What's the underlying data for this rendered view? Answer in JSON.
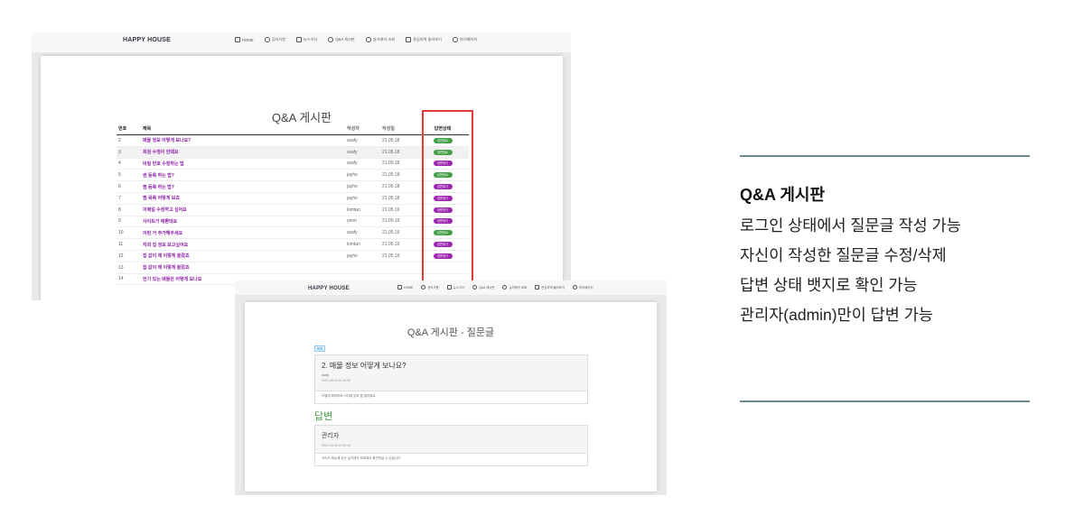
{
  "list_screen": {
    "brand": "HAPPY HOUSE",
    "nav": [
      {
        "icon": "home-icon",
        "label": "HOME"
      },
      {
        "icon": "info-icon",
        "label": "공지사항"
      },
      {
        "icon": "news-icon",
        "label": "뉴스기사"
      },
      {
        "icon": "qna-icon",
        "label": "Q&A 게시판"
      },
      {
        "icon": "search-icon",
        "label": "실거래가 조회"
      },
      {
        "icon": "bookmark-icon",
        "label": "관심지역 둘러보기"
      },
      {
        "icon": "user-icon",
        "label": "마이페이지"
      }
    ],
    "title": "Q&A 게시판",
    "columns": {
      "no": "번호",
      "title": "제목",
      "author": "작성자",
      "date": "작성일",
      "status": "답변상태"
    },
    "rows": [
      {
        "no": "2",
        "title": "매물 정보 어떻게 보나요?",
        "author": "ssafy",
        "date": "21.05.18",
        "status": "답변완료",
        "state": "done"
      },
      {
        "no": "3",
        "title": "회원 수정이 안돼요",
        "author": "ssafy",
        "date": "21.05.18",
        "status": "답변완료",
        "state": "done"
      },
      {
        "no": "4",
        "title": "비밀 번호 수정하는 법",
        "author": "ssafy",
        "date": "21.05.18",
        "status": "답변대기",
        "state": "wait"
      },
      {
        "no": "5",
        "title": "썸 등록 하는 법?",
        "author": "jayho",
        "date": "21.05.18",
        "status": "답변완료",
        "state": "done"
      },
      {
        "no": "6",
        "title": "찜 등록 하는 법?",
        "author": "jayho",
        "date": "21.05.18",
        "status": "답변대기",
        "state": "wait"
      },
      {
        "no": "7",
        "title": "찜 목록 어떻게 보죠",
        "author": "jayho",
        "date": "21.05.18",
        "status": "답변대기",
        "state": "wait"
      },
      {
        "no": "8",
        "title": "이메일 수정하고 싶어요",
        "author": "kimtan",
        "date": "21.05.19",
        "status": "답변대기",
        "state": "wait"
      },
      {
        "no": "9",
        "title": "사이트가 예쁜데요",
        "author": "yeon",
        "date": "21.05.19",
        "status": "답변대기",
        "state": "wait"
      },
      {
        "no": "10",
        "title": "이런 거 추가해주세요",
        "author": "ssafy",
        "date": "21.05.19",
        "status": "답변완료",
        "state": "done"
      },
      {
        "no": "11",
        "title": "저희 집 정보 보고싶어요",
        "author": "kimtan",
        "date": "21.05.19",
        "status": "답변대기",
        "state": "wait"
      },
      {
        "no": "12",
        "title": "집 값이 왜 이렇게 올랐죠",
        "author": "jayho",
        "date": "21.05.19",
        "status": "답변대기",
        "state": "wait"
      },
      {
        "no": "13",
        "title": "집 값이 왜 이렇게 올랐죠",
        "author": "",
        "date": "",
        "status": "",
        "state": ""
      },
      {
        "no": "14",
        "title": "인기 있는 매물은 어떻게 보나요",
        "author": "",
        "date": "",
        "status": "",
        "state": ""
      }
    ]
  },
  "detail_screen": {
    "brand": "HAPPY HOUSE",
    "nav": [
      {
        "icon": "home-icon",
        "label": "HOME"
      },
      {
        "icon": "info-icon",
        "label": "공지사항"
      },
      {
        "icon": "news-icon",
        "label": "뉴스기사"
      },
      {
        "icon": "qna-icon",
        "label": "Q&A 게시판"
      },
      {
        "icon": "search-icon",
        "label": "실거래가 조회"
      },
      {
        "icon": "bookmark-icon",
        "label": "관심지역 둘러보기"
      },
      {
        "icon": "user-icon",
        "label": "마이페이지"
      }
    ],
    "title": "Q&A 게시판 - 질문글",
    "list_button": "목록",
    "question": {
      "title": "2. 매물 정보 어떻게 보나요?",
      "author": "ssafy",
      "date": "2021.05.18 15:38:00",
      "body": "어떻게 봐야하죠 어디에 있죠 좀 알려줘요"
    },
    "answer_heading": "답변",
    "answer": {
      "name": "관리자",
      "date": "2022.05.26 10:59:44",
      "body": "사이드 메뉴에 있는 실거래가 조회에서 확인하실 수 있습니다"
    }
  },
  "description": {
    "title": "Q&A 게시판",
    "lines": [
      "로그인 상태에서 질문글 작성 가능",
      "자신이 작성한 질문글 수정/삭제",
      "답변 상태 뱃지로 확인 가능",
      "관리자(admin)만이 답변 가능"
    ]
  },
  "colors": {
    "badge_done": "#43a047",
    "badge_wait": "#9c27b0",
    "highlight_box": "#e53935",
    "rule": "#6e8a90",
    "answer_heading": "#43a047"
  }
}
